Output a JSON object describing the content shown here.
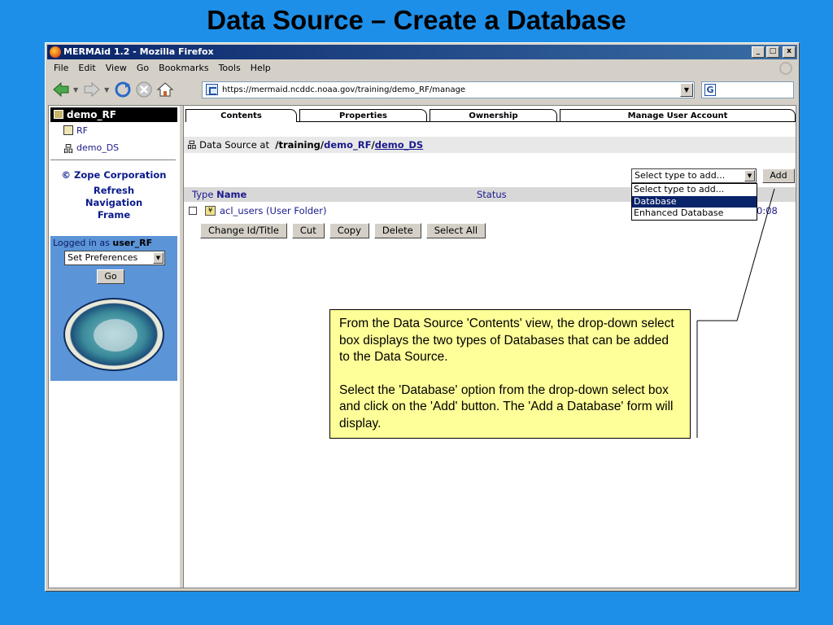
{
  "slide": {
    "title": "Data Source – Create a Database"
  },
  "window": {
    "title": "MERMAid 1.2 - Mozilla Firefox",
    "controls": [
      "_",
      "□",
      "x"
    ]
  },
  "menu": {
    "file": "File",
    "edit": "Edit",
    "view": "View",
    "go": "Go",
    "bookmarks": "Bookmarks",
    "tools": "Tools",
    "help": "Help"
  },
  "navbar": {
    "url": "https://mermaid.ncddc.noaa.gov/training/demo_RF/manage",
    "search_glyph": "G"
  },
  "left_frame": {
    "tree_root": "demo_RF",
    "tree_items": [
      "RF",
      "demo_DS"
    ],
    "zope": "© Zope Corporation",
    "refresh_lines": [
      "Refresh",
      "Navigation",
      "Frame"
    ],
    "logged_in_prefix": "Logged in as",
    "user": "user_RF",
    "preferences_select": "Set Preferences",
    "go_button": "Go"
  },
  "tabs": [
    "Contents",
    "Properties",
    "Ownership",
    "Manage User Account"
  ],
  "path": {
    "prefix": "Data Source at",
    "base": "/training/",
    "link1": "demo_RF",
    "sep": "/",
    "link2": "demo_DS"
  },
  "add_control": {
    "selected": "Select type to add...",
    "options": [
      "Select type to add...",
      "Database",
      "Enhanced Database"
    ],
    "highlighted_index": 1,
    "add_button": "Add"
  },
  "table": {
    "col_type": "Type",
    "col_name": "Name",
    "col_status": "Status",
    "rows": [
      {
        "name": "acl_users (User Folder)",
        "time_fragment": "0:08"
      }
    ]
  },
  "actions": [
    "Change Id/Title",
    "Cut",
    "Copy",
    "Delete",
    "Select All"
  ],
  "callout": {
    "para1": "From the Data Source 'Contents' view, the drop-down select box displays the two types of Databases that can be added to the Data Source.",
    "para2": "Select the 'Database' option from the drop-down select box and click on the 'Add' button. The 'Add a Database' form will display."
  },
  "colors": {
    "slide_background": "#1d8fe8",
    "titlebar": "#0a246a",
    "link": "#1a1a8c",
    "login_panel": "#5c94d8",
    "callout": "#ffff99",
    "selection": "#0a246a"
  }
}
